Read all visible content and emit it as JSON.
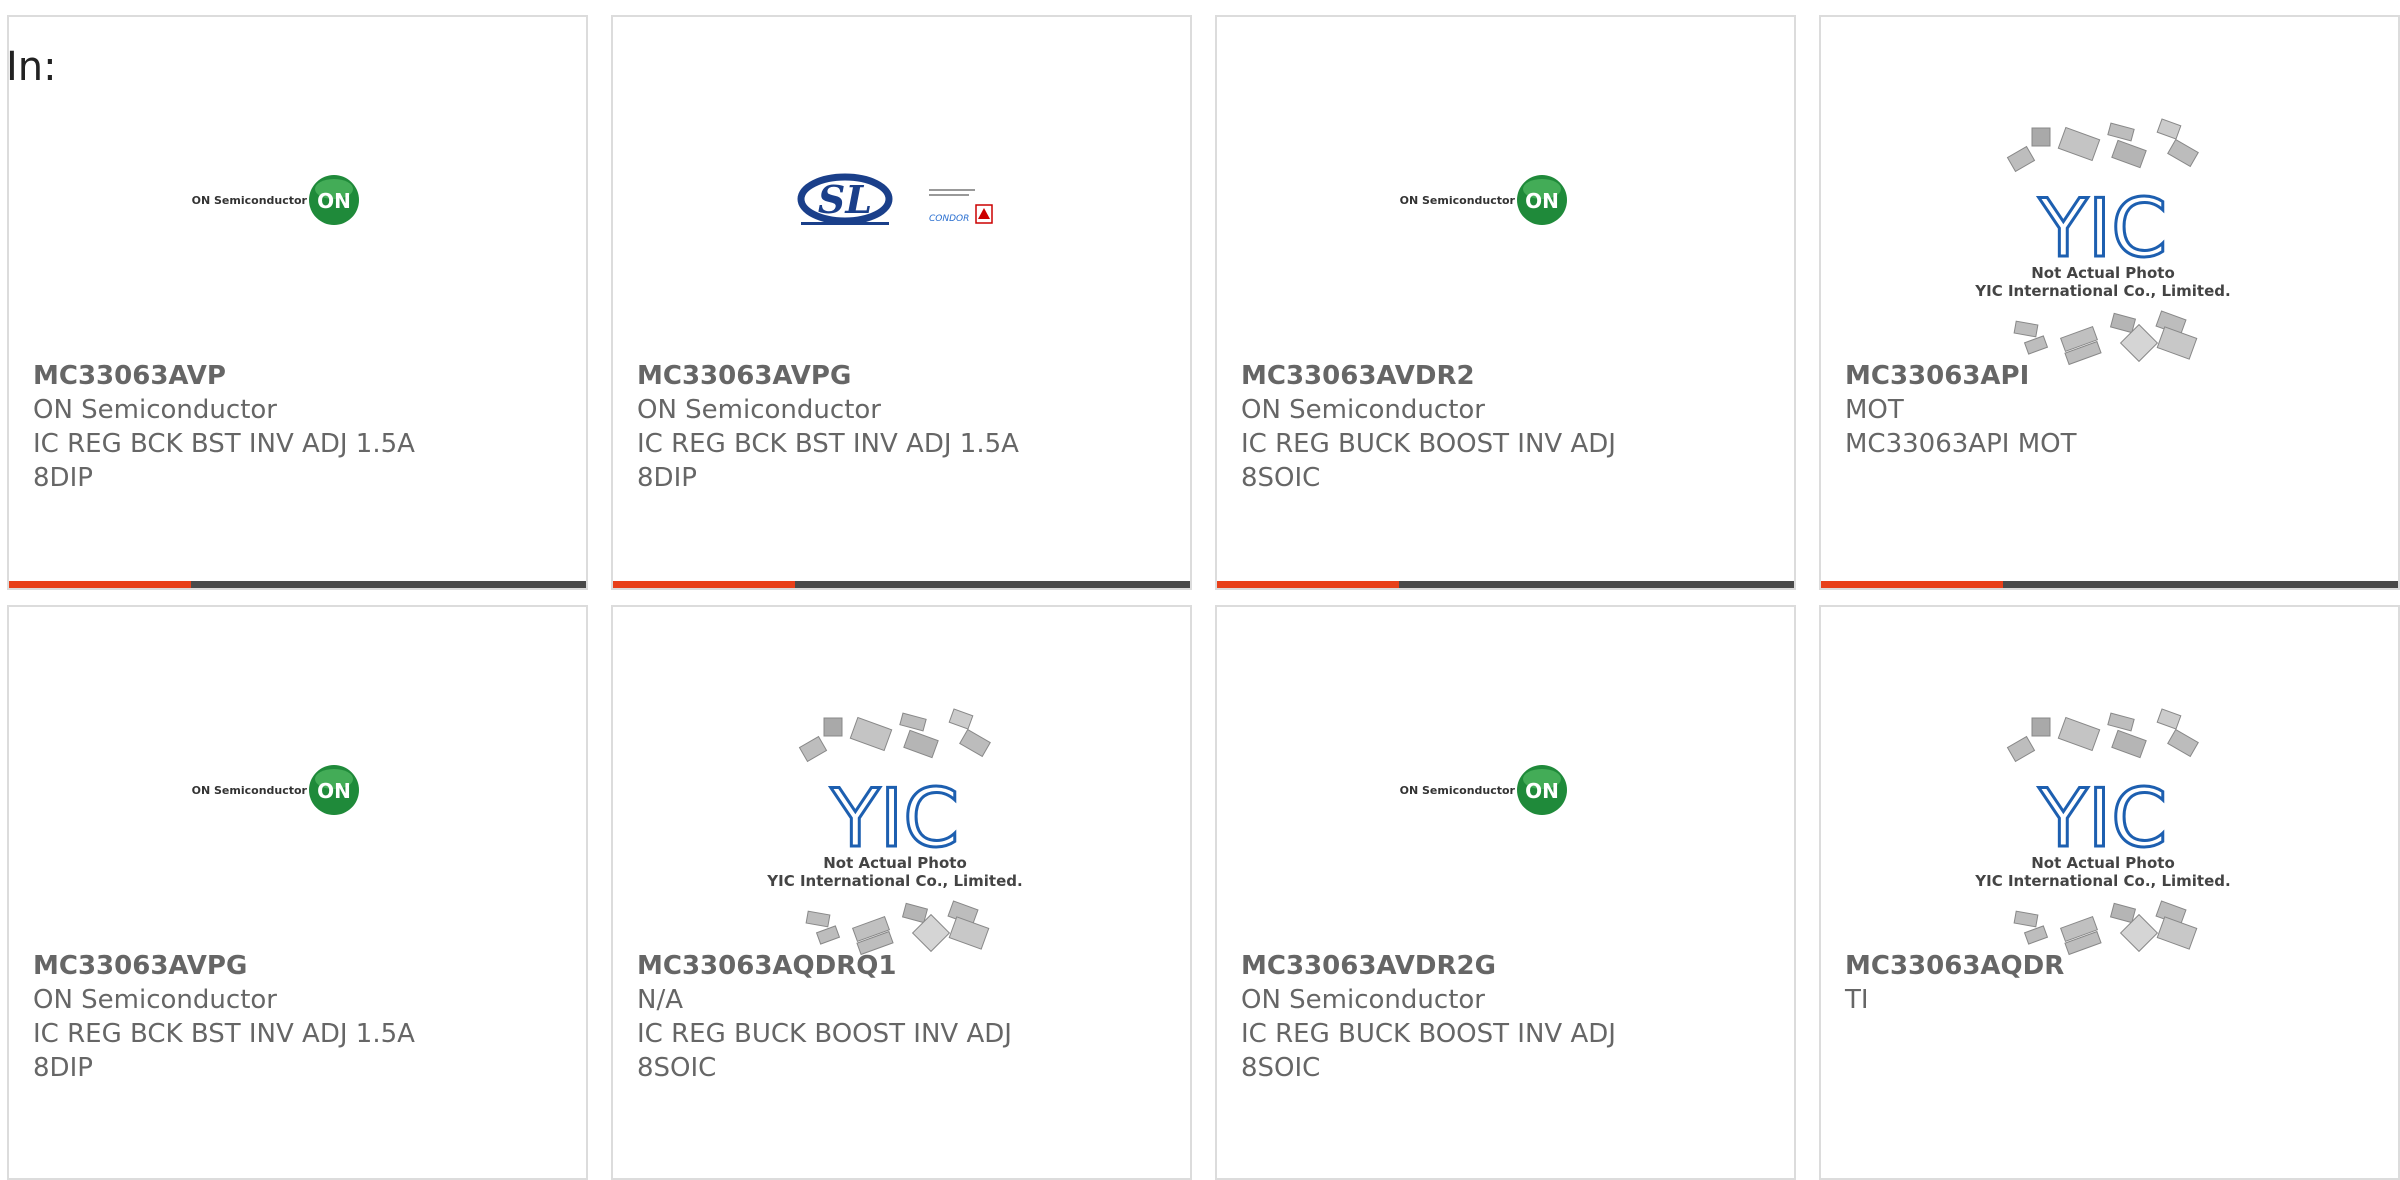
{
  "filter": {
    "label": "In:"
  },
  "accent_color": "#e8401a",
  "bar_color": "#4a4a4a",
  "cards": [
    {
      "part": "MC33063AVP",
      "lines": [
        "ON Semiconductor",
        "IC REG BCK BST INV ADJ 1.5A",
        "8DIP"
      ],
      "logo": "on-semiconductor-logo",
      "logo_text": "ON Semiconductor",
      "badge": "ON"
    },
    {
      "part": "MC33063AVPG",
      "lines": [
        "ON Semiconductor",
        "IC REG BCK BST INV ADJ 1.5A",
        "8DIP"
      ],
      "logo": "sl-power-electronics-logo",
      "logo_text": "SL",
      "logo_sub": "CONDOR"
    },
    {
      "part": "MC33063AVDR2",
      "lines": [
        "ON Semiconductor",
        "IC REG BUCK BOOST INV ADJ",
        "8SOIC"
      ],
      "logo": "on-semiconductor-logo",
      "logo_text": "ON Semiconductor",
      "badge": "ON"
    },
    {
      "part": "MC33063API",
      "lines": [
        "MOT",
        "MC33063API MOT"
      ],
      "logo": "yic-placeholder-logo",
      "logo_text": "YIC",
      "caption1": "Not Actual Photo",
      "caption2": "YIC International Co., Limited."
    },
    {
      "part": "MC33063AVPG",
      "lines": [
        "ON Semiconductor",
        "IC REG BCK BST INV ADJ 1.5A",
        "8DIP"
      ],
      "logo": "on-semiconductor-logo",
      "logo_text": "ON Semiconductor",
      "badge": "ON"
    },
    {
      "part": "MC33063AQDRQ1",
      "lines": [
        "N/A",
        "IC REG BUCK BOOST INV ADJ",
        "8SOIC"
      ],
      "logo": "yic-placeholder-logo",
      "logo_text": "YIC",
      "caption1": "Not Actual Photo",
      "caption2": "YIC International Co., Limited."
    },
    {
      "part": "MC33063AVDR2G",
      "lines": [
        "ON Semiconductor",
        "IC REG BUCK BOOST INV ADJ",
        "8SOIC"
      ],
      "logo": "on-semiconductor-logo",
      "logo_text": "ON Semiconductor",
      "badge": "ON"
    },
    {
      "part": "MC33063AQDR",
      "lines": [
        "TI"
      ],
      "logo": "yic-placeholder-logo",
      "logo_text": "YIC",
      "caption1": "Not Actual Photo",
      "caption2": "YIC International Co., Limited."
    }
  ]
}
